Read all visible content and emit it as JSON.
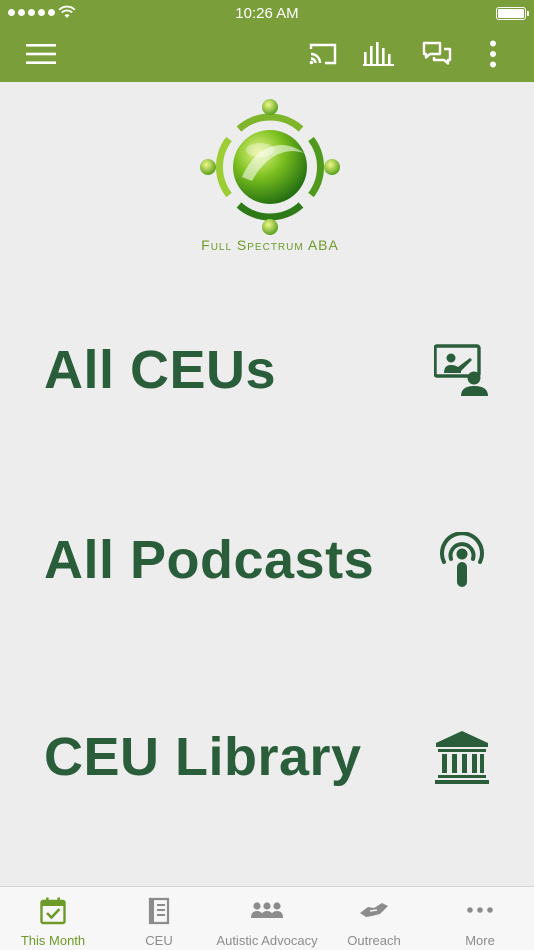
{
  "status_bar": {
    "time": "10:26 AM"
  },
  "app_bar": {
    "menu_icon": "hamburger-icon",
    "actions": [
      "cast-icon",
      "stats-icon",
      "chat-icon",
      "more-vert-icon"
    ]
  },
  "brand": {
    "name": "Full Spectrum ABA"
  },
  "menu": [
    {
      "label": "All CEUs",
      "icon": "presentation-icon"
    },
    {
      "label": "All Podcasts",
      "icon": "podcast-icon"
    },
    {
      "label": "CEU Library",
      "icon": "library-icon"
    }
  ],
  "tabs": [
    {
      "label": "This Month",
      "icon": "calendar-check-icon",
      "active": true
    },
    {
      "label": "CEU",
      "icon": "book-icon",
      "active": false
    },
    {
      "label": "Autistic Advocacy",
      "icon": "group-icon",
      "active": false
    },
    {
      "label": "Outreach",
      "icon": "handshake-icon",
      "active": false
    },
    {
      "label": "More",
      "icon": "more-horiz-icon",
      "active": false
    }
  ],
  "colors": {
    "primary": "#7a9e3a",
    "heading": "#2a5e3a",
    "background": "#ededed",
    "tab_active": "#6e9a2a",
    "tab_inactive": "#8c8c8c"
  }
}
